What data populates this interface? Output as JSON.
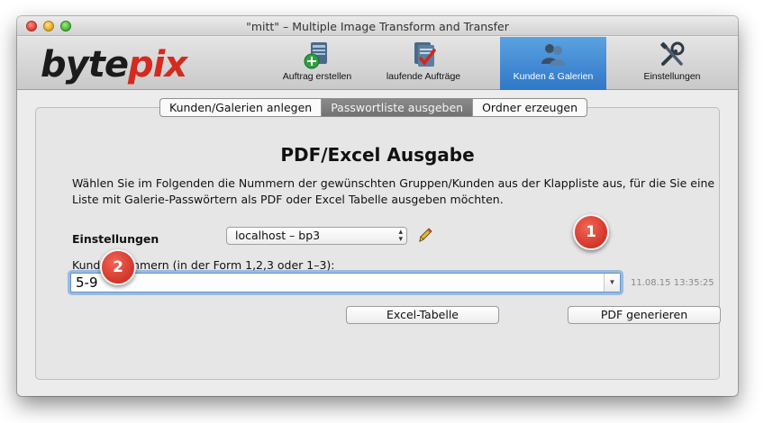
{
  "window": {
    "title": "\"mitt\" – Multiple Image Transform and Transfer"
  },
  "toolbar": {
    "logo_part1": "byte",
    "logo_part2": "pix",
    "buttons": [
      {
        "label": "Auftrag erstellen",
        "icon": "add-order-icon"
      },
      {
        "label": "laufende Aufträge",
        "icon": "running-orders-icon"
      },
      {
        "label": "Kunden & Galerien",
        "icon": "customers-galleries-icon",
        "active": true
      },
      {
        "label": "Einstellungen",
        "icon": "tools-icon"
      }
    ]
  },
  "tabs": [
    {
      "label": "Kunden/Galerien anlegen"
    },
    {
      "label": "Passwortliste ausgeben",
      "selected": true
    },
    {
      "label": "Ordner erzeugen"
    }
  ],
  "main": {
    "heading": "PDF/Excel Ausgabe",
    "description": "Wählen Sie im Folgenden die Nummern der gewünschten Gruppen/Kunden aus der Klappliste aus, für die Sie eine Liste mit Galerie-Passwörtern als PDF oder Excel Tabelle ausgeben möchten.",
    "settings_label": "Einstellungen",
    "settings_value": "localhost – bp3",
    "kunden_label": "Kundennummern (in der Form 1,2,3 oder 1–3):",
    "kunden_value": "5-9",
    "timestamp": "11.08.15 13:35:25",
    "excel_button": "Excel-Tabelle",
    "pdf_button": "PDF generieren"
  },
  "annotations": {
    "marker1": "1",
    "marker2": "2"
  },
  "colors": {
    "accent": "#3a83d0",
    "marker": "#d1352a",
    "logo_red": "#d42a1f"
  }
}
